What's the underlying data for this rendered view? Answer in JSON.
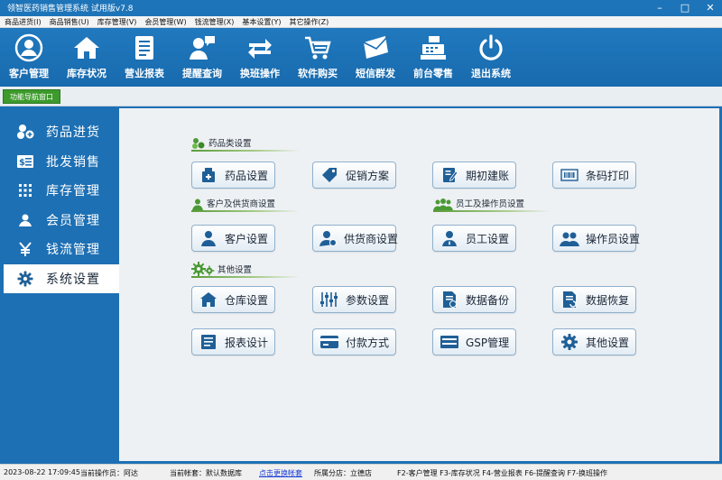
{
  "window": {
    "title": "领智医药销售管理系统 试用版v7.8"
  },
  "menu": [
    "商品进货(I)",
    "商品销售(U)",
    "库存管理(V)",
    "会员管理(W)",
    "钱流管理(X)",
    "基本设置(Y)",
    "其它操作(Z)"
  ],
  "toolbar": [
    {
      "label": "客户管理",
      "icon": "user-circle-icon"
    },
    {
      "label": "库存状况",
      "icon": "house-icon"
    },
    {
      "label": "营业报表",
      "icon": "report-icon"
    },
    {
      "label": "提醒查询",
      "icon": "reminder-icon"
    },
    {
      "label": "换班操作",
      "icon": "swap-icon"
    },
    {
      "label": "软件购买",
      "icon": "cart-icon"
    },
    {
      "label": "短信群发",
      "icon": "envelope-icon"
    },
    {
      "label": "前台零售",
      "icon": "cash-register-icon"
    },
    {
      "label": "退出系统",
      "icon": "power-icon"
    }
  ],
  "nav_tab": "功能导航窗口",
  "sidebar": [
    {
      "label": "药品进货",
      "icon": "pills-add-icon",
      "active": false
    },
    {
      "label": "批发销售",
      "icon": "sale-icon",
      "active": false
    },
    {
      "label": "库存管理",
      "icon": "grid-icon",
      "active": false
    },
    {
      "label": "会员管理",
      "icon": "member-icon",
      "active": false
    },
    {
      "label": "钱流管理",
      "icon": "yen-icon",
      "active": false
    },
    {
      "label": "系统设置",
      "icon": "gear-icon",
      "active": true
    }
  ],
  "sections": {
    "drug": "药品类设置",
    "customer": "客户及供货商设置",
    "staff": "员工及操作员设置",
    "other": "其他设置"
  },
  "buttons": {
    "drug_setting": "药品设置",
    "promotion": "促销方案",
    "opening_account": "期初建账",
    "barcode_print": "条码打印",
    "customer_setting": "客户设置",
    "supplier_setting": "供货商设置",
    "employee_setting": "员工设置",
    "operator_setting": "操作员设置",
    "warehouse_setting": "仓库设置",
    "param_setting": "参数设置",
    "data_backup": "数据备份",
    "data_restore": "数据恢复",
    "report_design": "报表设计",
    "payment_method": "付款方式",
    "gsp_manage": "GSP管理",
    "other_setting": "其他设置"
  },
  "status": {
    "datetime": "2023-08-22 17:09:45",
    "operator": "当前操作员：阿达",
    "account": "当前帐套：默认数据库",
    "switch_link": "点击更换帐套",
    "branch": "所属分店：立德店",
    "shortcuts": "F2-客户管理 F3-库存状况 F4-营业报表 F6-提醒查询 F7-换班操作"
  },
  "colors": {
    "titlebar": "#1e74b8",
    "toolbar": "#1a6eb2",
    "frame": "#1e70b4",
    "nav_tab": "#3d9a2c",
    "button_icon": "#1f5f97"
  }
}
